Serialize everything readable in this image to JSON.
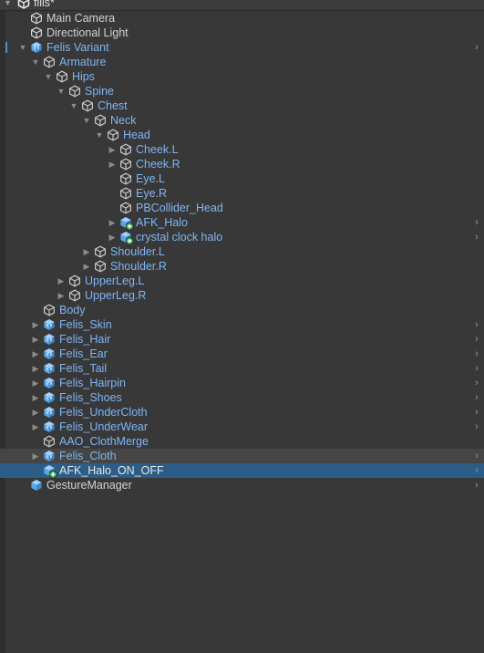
{
  "scene": {
    "name": "filis*"
  },
  "colors": {
    "prefab": "#7fb5f5",
    "selected_bg": "#2c5d87",
    "panel_bg": "#383838"
  },
  "rows": [
    {
      "label": "Main Camera",
      "depth": 0,
      "icon": "gameobject-icon",
      "style": "plain",
      "arrow": "none",
      "chevron": false
    },
    {
      "label": "Directional Light",
      "depth": 0,
      "icon": "gameobject-icon",
      "style": "plain",
      "arrow": "none",
      "chevron": false
    },
    {
      "label": "Felis Variant",
      "depth": 0,
      "icon": "prefab-variant-icon",
      "style": "prefab",
      "arrow": "expanded",
      "chevron": true
    },
    {
      "label": "Armature",
      "depth": 1,
      "icon": "gameobject-icon",
      "style": "prefab",
      "arrow": "expanded",
      "chevron": false
    },
    {
      "label": "Hips",
      "depth": 2,
      "icon": "gameobject-icon",
      "style": "prefab",
      "arrow": "expanded",
      "chevron": false
    },
    {
      "label": "Spine",
      "depth": 3,
      "icon": "gameobject-icon",
      "style": "prefab",
      "arrow": "expanded",
      "chevron": false
    },
    {
      "label": "Chest",
      "depth": 4,
      "icon": "gameobject-icon",
      "style": "prefab",
      "arrow": "expanded",
      "chevron": false
    },
    {
      "label": "Neck",
      "depth": 5,
      "icon": "gameobject-icon",
      "style": "prefab",
      "arrow": "expanded",
      "chevron": false
    },
    {
      "label": "Head",
      "depth": 6,
      "icon": "gameobject-icon",
      "style": "prefab",
      "arrow": "expanded",
      "chevron": false
    },
    {
      "label": "Cheek.L",
      "depth": 7,
      "icon": "gameobject-icon",
      "style": "prefab",
      "arrow": "collapsed",
      "chevron": false
    },
    {
      "label": "Cheek.R",
      "depth": 7,
      "icon": "gameobject-icon",
      "style": "prefab",
      "arrow": "collapsed",
      "chevron": false
    },
    {
      "label": "Eye.L",
      "depth": 7,
      "icon": "gameobject-icon",
      "style": "prefab",
      "arrow": "none",
      "chevron": false
    },
    {
      "label": "Eye.R",
      "depth": 7,
      "icon": "gameobject-icon",
      "style": "prefab",
      "arrow": "none",
      "chevron": false
    },
    {
      "label": "PBCollider_Head",
      "depth": 7,
      "icon": "gameobject-icon",
      "style": "prefab",
      "arrow": "none",
      "chevron": false
    },
    {
      "label": "AFK_Halo",
      "depth": 7,
      "icon": "added-prefab-icon",
      "style": "prefab",
      "arrow": "collapsed",
      "chevron": true
    },
    {
      "label": "crystal clock halo",
      "depth": 7,
      "icon": "added-prefab-icon",
      "style": "prefab",
      "arrow": "collapsed",
      "chevron": true
    },
    {
      "label": "Shoulder.L",
      "depth": 5,
      "icon": "gameobject-icon",
      "style": "prefab",
      "arrow": "collapsed",
      "chevron": false
    },
    {
      "label": "Shoulder.R",
      "depth": 5,
      "icon": "gameobject-icon",
      "style": "prefab",
      "arrow": "collapsed",
      "chevron": false
    },
    {
      "label": "UpperLeg.L",
      "depth": 3,
      "icon": "gameobject-icon",
      "style": "prefab",
      "arrow": "collapsed",
      "chevron": false
    },
    {
      "label": "UpperLeg.R",
      "depth": 3,
      "icon": "gameobject-icon",
      "style": "prefab",
      "arrow": "collapsed",
      "chevron": false
    },
    {
      "label": "Body",
      "depth": 1,
      "icon": "gameobject-icon",
      "style": "prefab",
      "arrow": "none",
      "chevron": false
    },
    {
      "label": "Felis_Skin",
      "depth": 1,
      "icon": "prefab-variant-icon",
      "style": "prefab",
      "arrow": "collapsed",
      "chevron": true
    },
    {
      "label": "Felis_Hair",
      "depth": 1,
      "icon": "prefab-variant-icon",
      "style": "prefab",
      "arrow": "collapsed",
      "chevron": true
    },
    {
      "label": "Felis_Ear",
      "depth": 1,
      "icon": "prefab-variant-icon",
      "style": "prefab",
      "arrow": "collapsed",
      "chevron": true
    },
    {
      "label": "Felis_Tail",
      "depth": 1,
      "icon": "prefab-variant-icon",
      "style": "prefab",
      "arrow": "collapsed",
      "chevron": true
    },
    {
      "label": "Felis_Hairpin",
      "depth": 1,
      "icon": "prefab-variant-icon",
      "style": "prefab",
      "arrow": "collapsed",
      "chevron": true
    },
    {
      "label": "Felis_Shoes",
      "depth": 1,
      "icon": "prefab-variant-icon",
      "style": "prefab",
      "arrow": "collapsed",
      "chevron": true
    },
    {
      "label": "Felis_UnderCloth",
      "depth": 1,
      "icon": "prefab-variant-icon",
      "style": "prefab",
      "arrow": "collapsed",
      "chevron": true
    },
    {
      "label": "Felis_UnderWear",
      "depth": 1,
      "icon": "prefab-variant-icon",
      "style": "prefab",
      "arrow": "collapsed",
      "chevron": true
    },
    {
      "label": "AAO_ClothMerge",
      "depth": 1,
      "icon": "gameobject-icon",
      "style": "prefab",
      "arrow": "none",
      "chevron": false
    },
    {
      "label": "Felis_Cloth",
      "depth": 1,
      "icon": "prefab-variant-icon",
      "style": "prefab",
      "arrow": "collapsed",
      "chevron": true,
      "hover": true
    },
    {
      "label": "AFK_Halo_ON_OFF",
      "depth": 1,
      "icon": "added-prefab-icon",
      "style": "white",
      "arrow": "none",
      "chevron": true,
      "selected": true
    },
    {
      "label": "GestureManager",
      "depth": 0,
      "icon": "prefab-icon",
      "style": "plain",
      "arrow": "none",
      "chevron": true
    }
  ]
}
